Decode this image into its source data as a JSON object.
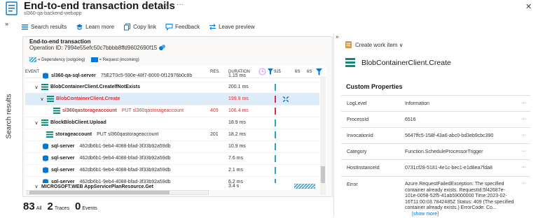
{
  "header": {
    "title": "End-to-end transaction details",
    "subtitle": "sl360-qa-backend-webapp",
    "pin_glyph": "✩",
    "more_glyph": "···",
    "close_glyph": "✕"
  },
  "rail": {
    "expand_glyph": "»",
    "label": "Search results"
  },
  "toolbar": {
    "search_results": "Search results",
    "learn_more": "Learn more",
    "copy_link": "Copy link",
    "feedback": "Feedback",
    "leave_preview": "Leave preview"
  },
  "transaction": {
    "label": "End-to-end transaction",
    "operation_id": "Operation ID: 7994e55efc50c7bbbb8ffd9602690f15"
  },
  "legend": {
    "dependency": "= Dependency (outgoing)",
    "request": "= Request (incoming)"
  },
  "table": {
    "headers": {
      "event": "EVENT",
      "res": "RES.",
      "duration": "DURATION",
      "t1": "925",
      "t2": "6S",
      "t3": "6S"
    },
    "rows": [
      {
        "twisty": "",
        "name": "sl360-qa-sql-server",
        "detail": "75E2T0c5-590e-48f7-8000-0f12976b0c8b",
        "res": "",
        "duration": "1.15 ms"
      },
      {
        "twisty": "∨",
        "name": "BlobContainerClient.CreateIfNotExists",
        "detail": "",
        "res": "",
        "duration": "200.1 ms"
      },
      {
        "twisty": "∨",
        "name": "BlobContainerClient.Create",
        "detail": "",
        "res": "",
        "duration": "199.9 ms"
      },
      {
        "twisty": "",
        "name": "sl360qastorageaccount",
        "detail": "PUT sl360qastorageaccount",
        "res": "409",
        "duration": "106.4 ms"
      },
      {
        "twisty": "∨",
        "name": "BlockBlobClient.Upload",
        "detail": "",
        "res": "",
        "duration": "18.9 ms"
      },
      {
        "twisty": "",
        "name": "storageaccount",
        "detail": "PUT sl360qastorageaccount",
        "res": "201",
        "duration": "18.2 ms"
      },
      {
        "twisty": "",
        "name": "sql-server",
        "detail": "462db6b1-9eb4-4088-bfad-3f33b92a59db",
        "res": "",
        "duration": "10.9 ms"
      },
      {
        "twisty": "",
        "name": "sql-server",
        "detail": "462db6b1-9eb4-4088-bfad-3f33b92a59db",
        "res": "",
        "duration": "7.6 ms"
      },
      {
        "twisty": "",
        "name": "sql-server",
        "detail": "462db6b1-9eb4-4088-bfad-3f33b92a59db",
        "res": "",
        "duration": "2.1 ms"
      },
      {
        "twisty": "",
        "name": "sql-server",
        "detail": "462db6b1-9eb4-4088-bfad-3f33b92a59db",
        "res": "",
        "duration": "6.2 ms"
      },
      {
        "twisty": "∨",
        "name": "MICROSOFT.WEB AppServicePlanResource.Get",
        "detail": "",
        "res": "",
        "duration": "3.4 s"
      }
    ]
  },
  "counts": {
    "all": {
      "value": "83",
      "label": "All"
    },
    "traces": {
      "value": "2",
      "label": "Traces"
    },
    "events": {
      "value": "0",
      "label": "Events"
    }
  },
  "details": {
    "collapse_glyph": "»",
    "create_work_item": "Create work item ∨",
    "title": "BlobContainerClient.Create",
    "section": "Custom Properties",
    "properties": [
      {
        "key": "LogLevel",
        "value": "Information"
      },
      {
        "key": "ProcessId",
        "value": "6516"
      },
      {
        "key": "InvocationId",
        "value": "5647ffc5-158f-43a6-abc0-bd3eb9cbc390"
      },
      {
        "key": "Category",
        "value": "Function.ScheduleProcessorTrigger"
      },
      {
        "key": "HostInstanceId",
        "value": "0731cf28-5181-4e1c-bec1-e1d8ea7fda8"
      },
      {
        "key": "Error",
        "value": "Azure.RequestFailedException: The specified container already exists. RequestId:5f42687e-101e-0058-52f5-41ab59000000 Time:2023-02-16T11:00:03.7842485Z Status: 409 (The specified container already exists.) ErrorCode: Co...",
        "link": "[show more]"
      }
    ],
    "row_more": "···"
  },
  "colors": {
    "accent": "#0078d4",
    "error": "#d13438",
    "selected": "#deecf9",
    "dependency": "#2ea0d8"
  }
}
